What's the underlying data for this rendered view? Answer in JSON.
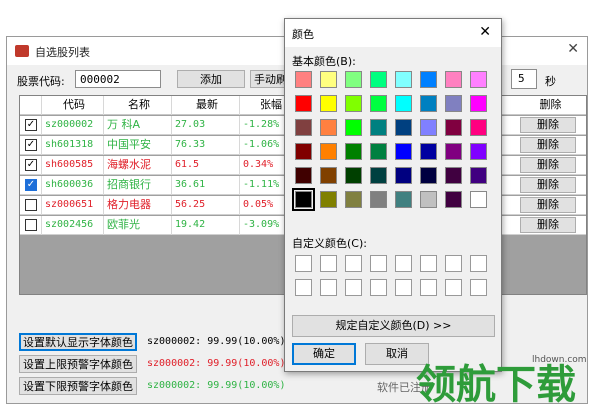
{
  "main_window": {
    "title": "自选股列表",
    "code_label": "股票代码:",
    "code_value": "000002",
    "add_button": "添加",
    "manual_refresh_button": "手动刷",
    "interval_value": "5",
    "interval_unit": "秒",
    "columns": [
      "代码",
      "名称",
      "最新",
      "张幅"
    ],
    "delete_header": "删除",
    "rows": [
      {
        "checked": true,
        "check_style": "normal",
        "code": "sz000002",
        "name": "万 科A",
        "price": "27.03",
        "change": "-1.28%",
        "color": "green",
        "delete": "删除"
      },
      {
        "checked": true,
        "check_style": "normal",
        "code": "sh601318",
        "name": "中国平安",
        "price": "76.33",
        "change": "-1.06%",
        "color": "green",
        "delete": "删除"
      },
      {
        "checked": true,
        "check_style": "normal",
        "code": "sh600585",
        "name": "海螺水泥",
        "price": "61.5",
        "change": "0.34%",
        "color": "red",
        "delete": "删除"
      },
      {
        "checked": true,
        "check_style": "blue",
        "code": "sh600036",
        "name": "招商银行",
        "price": "36.61",
        "change": "-1.11%",
        "color": "green",
        "delete": "删除"
      },
      {
        "checked": false,
        "check_style": "normal",
        "code": "sz000651",
        "name": "格力电器",
        "price": "56.25",
        "change": "0.05%",
        "color": "red",
        "delete": "删除"
      },
      {
        "checked": false,
        "check_style": "normal",
        "code": "sz002456",
        "name": "欧菲光",
        "price": "19.42",
        "change": "-3.09%",
        "color": "green",
        "delete": "删除"
      }
    ],
    "bottom_buttons": [
      {
        "label": "设置默认显示字体颜色",
        "status": "sz000002: 99.99(10.00%)"
      },
      {
        "label": "设置上限预警字体颜色",
        "status": "sz000002: 99.99(10.00%)"
      },
      {
        "label": "设置下限预警字体颜色",
        "status": "sz000002: 99.99(10.00%)"
      }
    ],
    "registered_text": "软件已注册"
  },
  "color_dialog": {
    "title": "颜色",
    "basic_colors_label": "基本颜色(B):",
    "custom_colors_label": "自定义颜色(C):",
    "define_custom_button": "规定自定义颜色(D) >>",
    "ok_button": "确定",
    "cancel_button": "取消",
    "basic_colors": [
      [
        "#ff8080",
        "#ffff80",
        "#80ff80",
        "#00ff80",
        "#80ffff",
        "#0080ff",
        "#ff80c0",
        "#ff80ff"
      ],
      [
        "#ff0000",
        "#ffff00",
        "#80ff00",
        "#00ff40",
        "#00ffff",
        "#0080c0",
        "#8080c0",
        "#ff00ff"
      ],
      [
        "#804040",
        "#ff8040",
        "#00ff00",
        "#008080",
        "#004080",
        "#8080ff",
        "#800040",
        "#ff0080"
      ],
      [
        "#800000",
        "#ff8000",
        "#008000",
        "#008040",
        "#0000ff",
        "#0000a0",
        "#800080",
        "#8000ff"
      ],
      [
        "#400000",
        "#804000",
        "#004000",
        "#004040",
        "#000080",
        "#000040",
        "#400040",
        "#400080"
      ],
      [
        "#000000",
        "#808000",
        "#808040",
        "#808080",
        "#408080",
        "#c0c0c0",
        "#400040",
        "#ffffff"
      ]
    ],
    "selected_color": "#000000"
  },
  "watermark": {
    "main_text": "领航下载",
    "url": "lhdown.com",
    "color": "#2e9c3a"
  }
}
